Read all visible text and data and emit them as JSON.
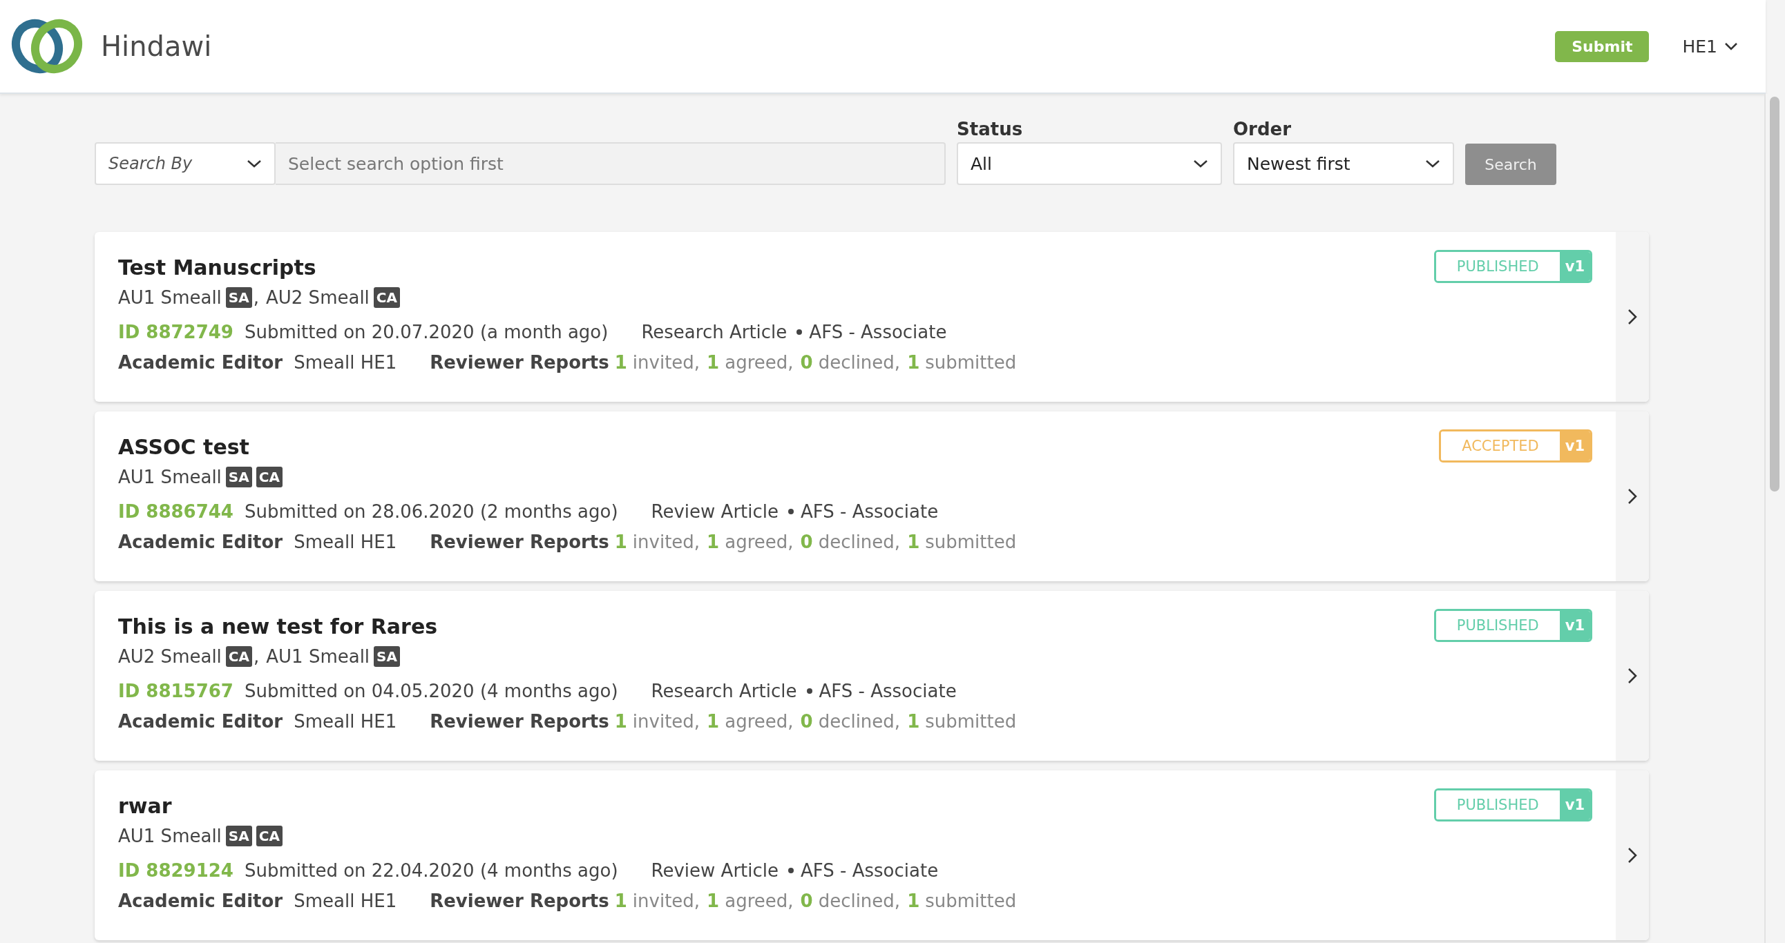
{
  "header": {
    "brand": "Hindawi",
    "submit_button": "Submit",
    "user_menu": "HE1"
  },
  "filters": {
    "search_by": "Search By",
    "search_field": {
      "placeholder": "Select search option first"
    },
    "status": {
      "label": "Status",
      "value": "All"
    },
    "order": {
      "label": "Order",
      "value": "Newest first"
    },
    "search_button": {
      "label": "Search",
      "disabled": true
    }
  },
  "manuscripts": [
    {
      "title": "Test Manuscripts",
      "authors": [
        {
          "name": "AU1 Smeall",
          "tags": [
            "SA"
          ],
          "separator": ","
        },
        {
          "name": "AU2 Smeall",
          "tags": [
            "CA"
          ]
        }
      ],
      "id": "ID 8872749",
      "submitted": "Submitted on 20.07.2020 (a month ago)",
      "article_type": "Research Article",
      "section": "AFS - Associate",
      "editor_label": "Academic Editor",
      "editor": "Smeall HE1",
      "reports_label": "Reviewer Reports",
      "reports": [
        {
          "count": "1",
          "label": "invited,"
        },
        {
          "count": "1",
          "label": "agreed,"
        },
        {
          "count": "0",
          "label": "declined,"
        },
        {
          "count": "1",
          "label": "submitted"
        }
      ],
      "status": {
        "kind": "published",
        "label": "PUBLISHED",
        "version": "v1"
      }
    },
    {
      "title": "ASSOC test",
      "authors": [
        {
          "name": "AU1 Smeall",
          "tags": [
            "SA",
            "CA"
          ]
        }
      ],
      "id": "ID 8886744",
      "submitted": "Submitted on 28.06.2020 (2 months ago)",
      "article_type": "Review Article",
      "section": "AFS - Associate",
      "editor_label": "Academic Editor",
      "editor": "Smeall HE1",
      "reports_label": "Reviewer Reports",
      "reports": [
        {
          "count": "1",
          "label": "invited,"
        },
        {
          "count": "1",
          "label": "agreed,"
        },
        {
          "count": "0",
          "label": "declined,"
        },
        {
          "count": "1",
          "label": "submitted"
        }
      ],
      "status": {
        "kind": "accepted",
        "label": "ACCEPTED",
        "version": "v1"
      }
    },
    {
      "title": "This is a new test for Rares",
      "authors": [
        {
          "name": "AU2 Smeall",
          "tags": [
            "CA"
          ],
          "separator": ","
        },
        {
          "name": "AU1 Smeall",
          "tags": [
            "SA"
          ]
        }
      ],
      "id": "ID 8815767",
      "submitted": "Submitted on 04.05.2020 (4 months ago)",
      "article_type": "Research Article",
      "section": "AFS - Associate",
      "editor_label": "Academic Editor",
      "editor": "Smeall HE1",
      "reports_label": "Reviewer Reports",
      "reports": [
        {
          "count": "1",
          "label": "invited,"
        },
        {
          "count": "1",
          "label": "agreed,"
        },
        {
          "count": "0",
          "label": "declined,"
        },
        {
          "count": "1",
          "label": "submitted"
        }
      ],
      "status": {
        "kind": "published",
        "label": "PUBLISHED",
        "version": "v1"
      }
    },
    {
      "title": "rwar",
      "authors": [
        {
          "name": "AU1 Smeall",
          "tags": [
            "SA",
            "CA"
          ]
        }
      ],
      "id": "ID 8829124",
      "submitted": "Submitted on 22.04.2020 (4 months ago)",
      "article_type": "Review Article",
      "section": "AFS - Associate",
      "editor_label": "Academic Editor",
      "editor": "Smeall HE1",
      "reports_label": "Reviewer Reports",
      "reports": [
        {
          "count": "1",
          "label": "invited,"
        },
        {
          "count": "1",
          "label": "agreed,"
        },
        {
          "count": "0",
          "label": "declined,"
        },
        {
          "count": "1",
          "label": "submitted"
        }
      ],
      "status": {
        "kind": "published",
        "label": "PUBLISHED",
        "version": "v1"
      }
    }
  ]
}
